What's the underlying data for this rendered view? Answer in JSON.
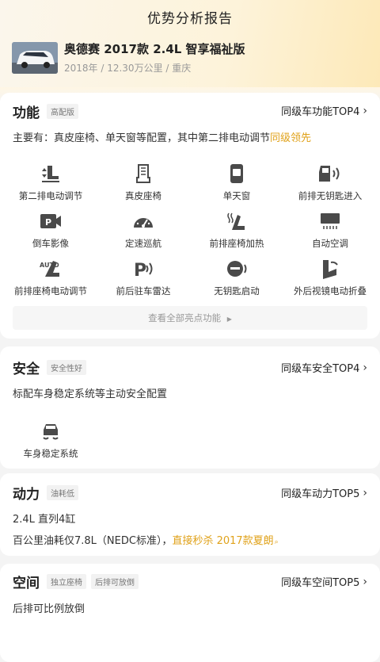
{
  "header": {
    "title": "优势分析报告",
    "car_name": "奥德赛 2017款 2.4L 智享福祉版",
    "car_meta": "2018年 / 12.30万公里 / 重庆"
  },
  "features_section": {
    "title": "功能",
    "tag": "高配版",
    "link": "同级车功能TOP4",
    "desc_prefix": "主要有：真皮座椅、单天窗等配置，其中第二排电动调节",
    "desc_highlight": "同级领先",
    "items": [
      {
        "label": "第二排电动调节",
        "icon": "seat-adjust-icon"
      },
      {
        "label": "真皮座椅",
        "icon": "leather-seat-icon"
      },
      {
        "label": "单天窗",
        "icon": "sunroof-icon"
      },
      {
        "label": "前排无钥匙进入",
        "icon": "keyless-entry-icon"
      },
      {
        "label": "倒车影像",
        "icon": "reverse-camera-icon"
      },
      {
        "label": "定速巡航",
        "icon": "cruise-control-icon"
      },
      {
        "label": "前排座椅加热",
        "icon": "seat-heating-icon"
      },
      {
        "label": "自动空调",
        "icon": "auto-ac-icon"
      },
      {
        "label": "前排座椅电动调节",
        "icon": "auto-seat-icon"
      },
      {
        "label": "前后驻车雷达",
        "icon": "parking-radar-icon"
      },
      {
        "label": "无钥匙启动",
        "icon": "keyless-start-icon"
      },
      {
        "label": "外后视镜电动折叠",
        "icon": "mirror-fold-icon"
      }
    ],
    "more_label": "查看全部亮点功能",
    "more_icon": "triangle-right-icon"
  },
  "safety_section": {
    "title": "安全",
    "tag": "安全性好",
    "link": "同级车安全TOP4",
    "desc": "标配车身稳定系统等主动安全配置",
    "items": [
      {
        "label": "车身稳定系统",
        "icon": "stability-control-icon"
      }
    ]
  },
  "power_section": {
    "title": "动力",
    "tag": "油耗低",
    "link": "同级车动力TOP5",
    "line1": "2.4L 直列4缸",
    "line2_prefix": "百公里油耗仅7.8L（NEDC标准），",
    "line2_highlight": "直接秒杀 2017款夏朗"
  },
  "space_section": {
    "title": "空间",
    "tags": [
      "独立座椅",
      "后排可放倒"
    ],
    "link": "同级车空间TOP5",
    "desc": "后排可比例放倒"
  },
  "colors": {
    "accent": "#e0a21a",
    "icon": "#4a4a4a"
  }
}
